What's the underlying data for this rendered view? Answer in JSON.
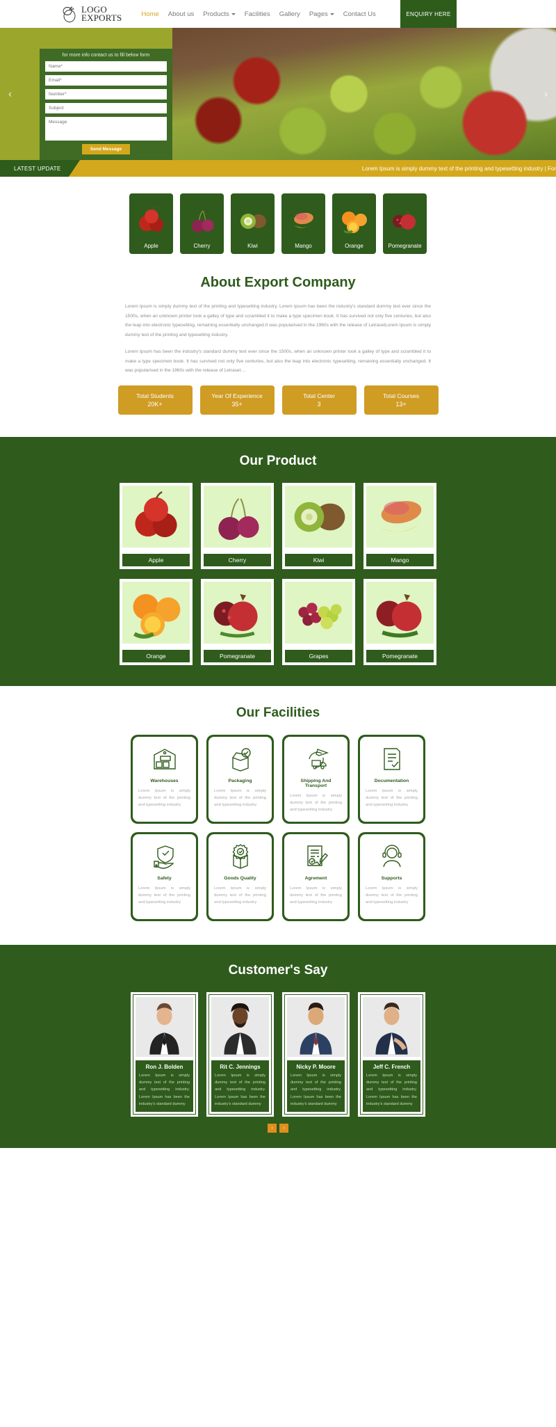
{
  "header": {
    "logo": {
      "line1": "LOGO",
      "line2": "EXPORTS",
      "icon": "fruit-outline-icon"
    },
    "nav": [
      {
        "label": "Home",
        "active": true,
        "caret": false
      },
      {
        "label": "About us",
        "active": false,
        "caret": false
      },
      {
        "label": "Products",
        "active": false,
        "caret": true
      },
      {
        "label": "Facilities",
        "active": false,
        "caret": false
      },
      {
        "label": "Gallery",
        "active": false,
        "caret": false
      },
      {
        "label": "Pages",
        "active": false,
        "caret": true
      },
      {
        "label": "Contact Us",
        "active": false,
        "caret": false
      }
    ],
    "enquiry_label": "ENQUIRY HERE"
  },
  "hero": {
    "form_heading": "for more info contact us to fill below form",
    "fields": {
      "name": "Name*",
      "email": "Email*",
      "number": "Number*",
      "subject": "Subject",
      "message": "Message"
    },
    "send_label": "Send Message",
    "prev_arrow": "‹",
    "next_arrow": "›"
  },
  "ticker": {
    "tag": "LATEST UPDATE",
    "text": "Lorem Ipsum is simply dummy text of the printing and typesetting industry | For"
  },
  "categories": [
    {
      "label": "Apple"
    },
    {
      "label": "Cherry"
    },
    {
      "label": "Kiwi"
    },
    {
      "label": "Mango"
    },
    {
      "label": "Orange"
    },
    {
      "label": "Pomegranate"
    }
  ],
  "about": {
    "title": "About Export Company",
    "paragraph1": "Lorem Ipsum is simply dummy text of the printing and typesetting industry. Lorem Ipsum has been the industry's standard dummy text ever since the 1500s, when an unknown printer took a galley of type and scrambled it to make a type specimen book. It has survived not only five centuries, but also the leap into electronic typesetting, remaining essentially unchanged.It was popularised in the 1960s with the release of LetrasetLorem Ipsum is simply dummy text of the printing and typesetting industry.",
    "paragraph2": "Lorem Ipsum has been the industry's standard dummy text ever since the 1500s, when an unknown printer took a galley of type and scrambled it to make a type specimen book. It has survived not only five centuries, but also the leap into electronic typesetting, remaining essentially unchanged. It was popularised in the 1960s with the release of Letraset....",
    "stats": [
      {
        "title": "Total Students",
        "value": "20K+"
      },
      {
        "title": "Year Of Experience",
        "value": "35+"
      },
      {
        "title": "Total Center",
        "value": "3"
      },
      {
        "title": "Total Courses",
        "value": "13+"
      }
    ]
  },
  "products": {
    "title": "Our Product",
    "items": [
      {
        "name": "Apple"
      },
      {
        "name": "Cherry"
      },
      {
        "name": "Kiwi"
      },
      {
        "name": "Mango"
      },
      {
        "name": "Orange"
      },
      {
        "name": "Pomegranate"
      },
      {
        "name": "Grapes"
      },
      {
        "name": "Pomegranate"
      }
    ]
  },
  "facilities": {
    "title": "Our Facilities",
    "items": [
      {
        "title": "Warehouses",
        "icon": "warehouse-icon",
        "desc": "Lorem Ipsum is simply dummy text of the printing and typesetting industry"
      },
      {
        "title": "Packaging",
        "icon": "open-box-check-icon",
        "desc": "Lorem Ipsum is simply dummy text of the printing and typesetting industry"
      },
      {
        "title": "Shipping And Transport",
        "icon": "plane-truck-globe-icon",
        "desc": "Lorem Ipsum is simply dummy text of the printing and typesetting industry"
      },
      {
        "title": "Documentation",
        "icon": "document-check-icon",
        "desc": "Lorem Ipsum is simply dummy text of the printing and typesetting industry"
      },
      {
        "title": "Safety",
        "icon": "shield-hand-icon",
        "desc": "Lorem Ipsum is simply dummy text of the printing and typesetting industry"
      },
      {
        "title": "Goods Quality",
        "icon": "quality-badge-box-icon",
        "desc": "Lorem Ipsum is simply dummy text of the printing and typesetting industry"
      },
      {
        "title": "Agrement",
        "icon": "contract-pen-icon",
        "desc": "Lorem Ipsum is simply dummy text of the printing and typesetting industry"
      },
      {
        "title": "Supports",
        "icon": "headset-agent-icon",
        "desc": "Lorem Ipsum is simply dummy text of the printing and typesetting industry"
      }
    ]
  },
  "testimonials": {
    "title": "Customer's Say",
    "prev": "‹",
    "next": "›",
    "items": [
      {
        "name": "Ron J. Bolden",
        "text": "Lorem Ipsum is simply dummy text of the printing and typesetting industry. Lorem Ipsum has been the industry's standard dummy"
      },
      {
        "name": "Rit C. Jennings",
        "text": "Lorem Ipsum is simply dummy text of the printing and typesetting industry. Lorem Ipsum has been the industry's standard dummy"
      },
      {
        "name": "Nicky P. Moore",
        "text": "Lorem Ipsum is simply dummy text of the printing and typesetting industry. Lorem Ipsum has been the industry's standard dummy"
      },
      {
        "name": "Jeff C. French",
        "text": "Lorem Ipsum is simply dummy text of the printing and typesetting industry. Lorem Ipsum has been the industry's standard dummy"
      }
    ]
  },
  "colors": {
    "brand_green": "#2f5b1d",
    "accent_gold": "#d4a81c",
    "olive": "#9aa62c",
    "product_bg": "#dff5c4"
  }
}
